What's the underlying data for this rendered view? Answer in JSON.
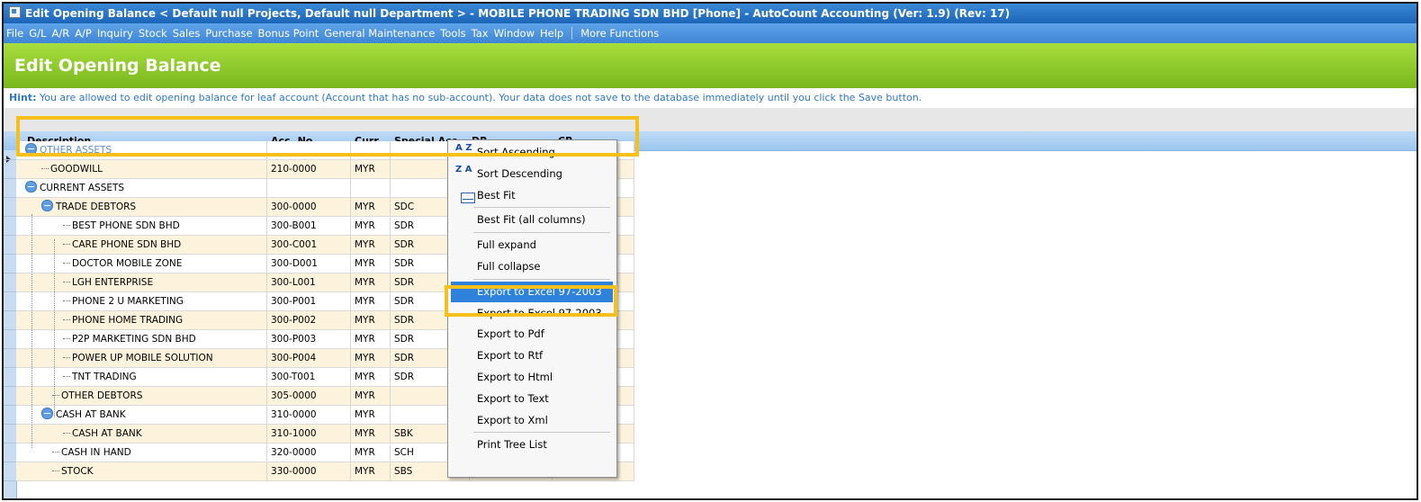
{
  "window": {
    "title": "Edit Opening Balance < Default null Projects, Default null Department > - MOBILE PHONE TRADING SDN BHD [Phone] - AutoCount Accounting (Ver: 1.9) (Rev: 17)"
  },
  "menu": {
    "items": [
      "File",
      "G/L",
      "A/R",
      "A/P",
      "Inquiry",
      "Stock",
      "Sales",
      "Purchase",
      "Bonus Point",
      "General Maintenance",
      "Tools",
      "Tax",
      "Window",
      "Help"
    ],
    "more": "More Functions"
  },
  "banner": {
    "title": "Edit Opening Balance"
  },
  "hint": {
    "label": "Hint:",
    "text": "You are allowed to edit opening balance for leaf account (Account that has no sub-account). Your data does not save to the database immediately until you click the Save button."
  },
  "grid": {
    "columns": [
      "Description",
      "Acc. No.",
      "Curr.",
      "Special Acc.",
      "DR",
      "CR"
    ],
    "rows": [
      {
        "desc": "OTHER ASSETS",
        "acc": "",
        "curr": "",
        "special": "",
        "group": true
      },
      {
        "desc": "GOODWILL",
        "acc": "210-0000",
        "curr": "MYR",
        "special": ""
      },
      {
        "desc": "CURRENT ASSETS",
        "acc": "",
        "curr": "",
        "special": "",
        "group": true
      },
      {
        "desc": "TRADE DEBTORS",
        "acc": "300-0000",
        "curr": "MYR",
        "special": "SDC",
        "group": true
      },
      {
        "desc": "BEST PHONE SDN BHD",
        "acc": "300-B001",
        "curr": "MYR",
        "special": "SDR"
      },
      {
        "desc": "CARE PHONE SDN BHD",
        "acc": "300-C001",
        "curr": "MYR",
        "special": "SDR"
      },
      {
        "desc": "DOCTOR MOBILE ZONE",
        "acc": "300-D001",
        "curr": "MYR",
        "special": "SDR"
      },
      {
        "desc": "LGH ENTERPRISE",
        "acc": "300-L001",
        "curr": "MYR",
        "special": "SDR"
      },
      {
        "desc": "PHONE 2 U MARKETING",
        "acc": "300-P001",
        "curr": "MYR",
        "special": "SDR"
      },
      {
        "desc": "PHONE HOME TRADING",
        "acc": "300-P002",
        "curr": "MYR",
        "special": "SDR"
      },
      {
        "desc": "P2P MARKETING SDN BHD",
        "acc": "300-P003",
        "curr": "MYR",
        "special": "SDR"
      },
      {
        "desc": "POWER UP MOBILE SOLUTION",
        "acc": "300-P004",
        "curr": "MYR",
        "special": "SDR"
      },
      {
        "desc": "TNT TRADING",
        "acc": "300-T001",
        "curr": "MYR",
        "special": "SDR"
      },
      {
        "desc": "OTHER DEBTORS",
        "acc": "305-0000",
        "curr": "MYR",
        "special": ""
      },
      {
        "desc": "CASH AT BANK",
        "acc": "310-0000",
        "curr": "MYR",
        "special": "",
        "group": true
      },
      {
        "desc": "CASH AT BANK",
        "acc": "310-1000",
        "curr": "MYR",
        "special": "SBK"
      },
      {
        "desc": "CASH IN HAND",
        "acc": "320-0000",
        "curr": "MYR",
        "special": "SCH"
      },
      {
        "desc": "STOCK",
        "acc": "330-0000",
        "curr": "MYR",
        "special": "SBS"
      }
    ]
  },
  "context_menu": {
    "items": [
      {
        "label": "Sort Ascending",
        "icon": "sort-ascending-icon",
        "icon_text": "A Z"
      },
      {
        "label": "Sort Descending",
        "icon": "sort-descending-icon",
        "icon_text": "Z A"
      },
      {
        "label": "Best Fit",
        "icon": "best-fit-icon"
      },
      {
        "label": "Best Fit (all columns)",
        "sep_before": true
      },
      {
        "label": "Full expand",
        "sep_before": true
      },
      {
        "label": "Full collapse"
      },
      {
        "label": "Export to Excel 97-2003",
        "sep_before": true,
        "selected": true
      },
      {
        "label": "Export to Excel 97-2003"
      },
      {
        "label": "Export to Pdf"
      },
      {
        "label": "Export to Rtf"
      },
      {
        "label": "Export to Html"
      },
      {
        "label": "Export to Text"
      },
      {
        "label": "Export to Xml"
      },
      {
        "label": "Print Tree List",
        "sep_before": true
      }
    ]
  },
  "colors": {
    "title_bar": "#1c64b8",
    "banner": "#8cc92a",
    "highlight": "#f6bf1a",
    "selected_item": "#2f82dc",
    "row_alt": "#fdf3dc"
  }
}
